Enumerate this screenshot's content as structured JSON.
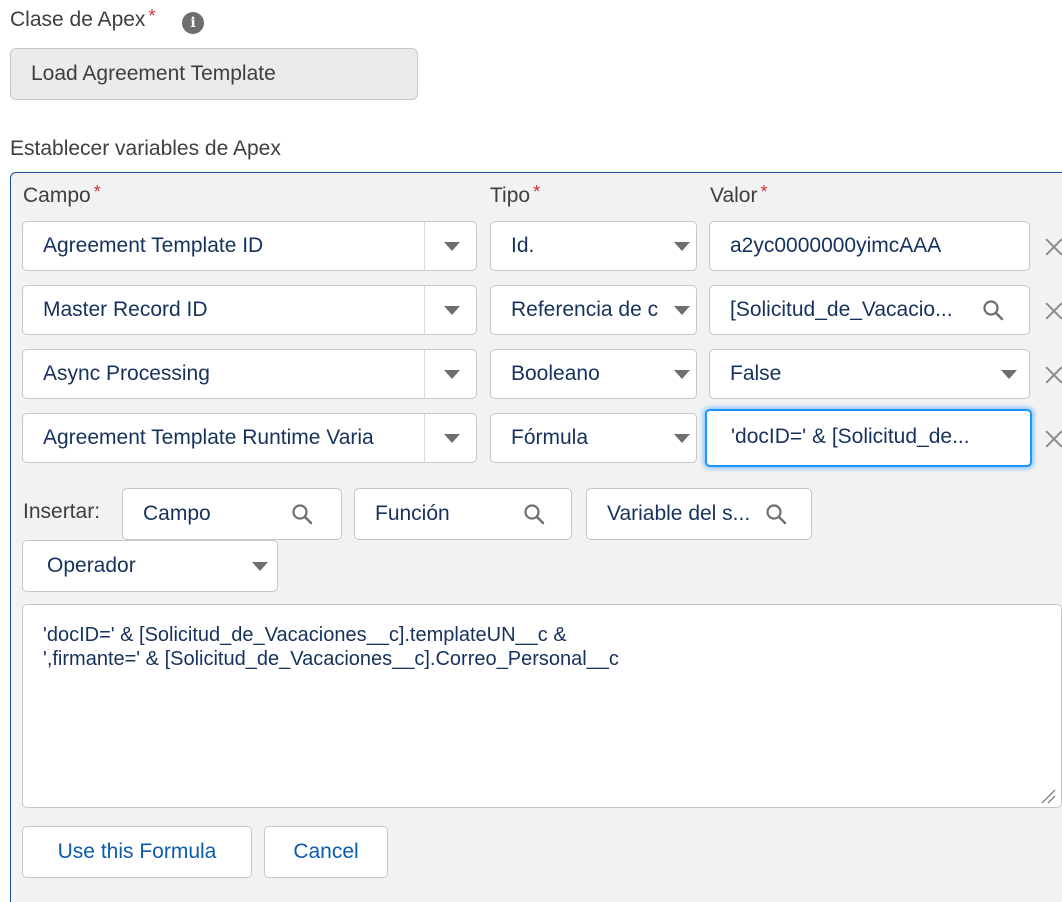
{
  "apex_class": {
    "label": "Clase de Apex",
    "required_mark": "*",
    "info_icon": "info-icon",
    "value": "Load Agreement Template"
  },
  "variables_section": {
    "label": "Establecer variables de Apex",
    "headers": {
      "campo": "Campo",
      "tipo": "Tipo",
      "valor": "Valor",
      "required_mark": "*"
    },
    "rows": [
      {
        "campo": "Agreement Template ID",
        "tipo": "Id.",
        "valor": "a2yc0000000yimcAAA",
        "valor_kind": "text"
      },
      {
        "campo": "Master Record ID",
        "tipo": "Referencia de c",
        "valor": "[Solicitud_de_Vacacio...",
        "valor_kind": "search"
      },
      {
        "campo": "Async Processing",
        "tipo": "Booleano",
        "valor": "False",
        "valor_kind": "picklist"
      },
      {
        "campo": "Agreement Template Runtime Varia",
        "tipo": "Fórmula",
        "valor": "'docID=' & [Solicitud_de...",
        "valor_kind": "text-focused"
      }
    ]
  },
  "formula_editor": {
    "insert_label": "Insertar:",
    "campo_search": "Campo",
    "funcion_search": "Función",
    "variable_search": "Variable del s...",
    "operator_select": "Operador",
    "formula_text": "'docID=' & [Solicitud_de_Vacaciones__c].templateUN__c &\n',firmante=' & [Solicitud_de_Vacaciones__c].Correo_Personal__c",
    "use_button": "Use this Formula",
    "cancel_button": "Cancel"
  },
  "colors": {
    "link_blue": "#0b5cab",
    "required_red": "#c23934",
    "focus_blue": "#1b96ff",
    "panel_border": "#1b5297"
  }
}
